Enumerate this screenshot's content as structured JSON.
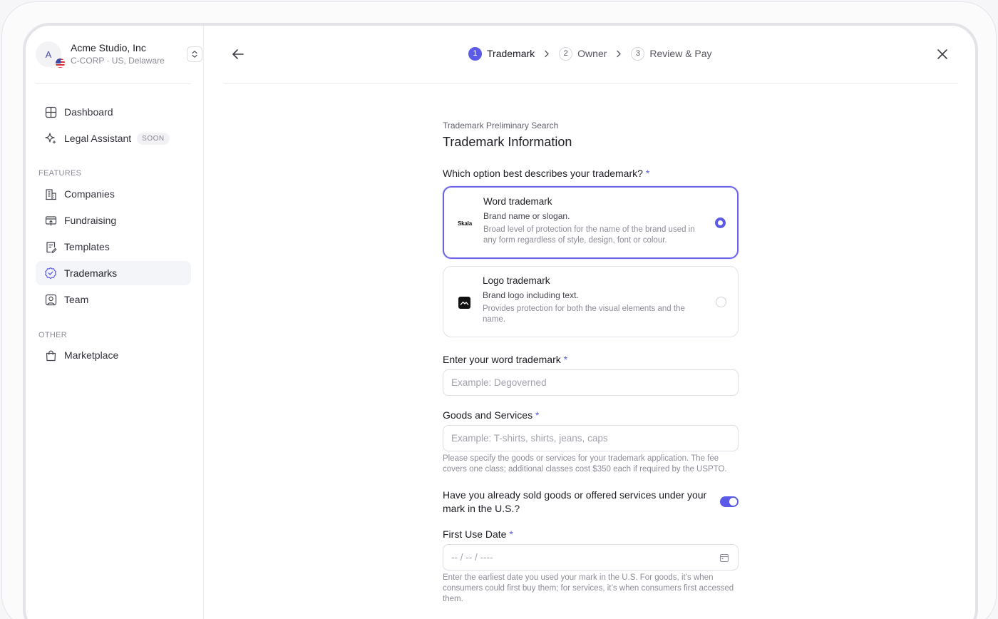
{
  "org": {
    "initial": "A",
    "name": "Acme Studio, Inc",
    "subtitle": "C-CORP · US, Delaware"
  },
  "sidebar": {
    "top_items": [
      {
        "label": "Dashboard",
        "icon": "dashboard-icon"
      },
      {
        "label": "Legal Assistant",
        "icon": "sparkle-icon",
        "badge": "SOON"
      }
    ],
    "features_label": "FEATURES",
    "features": [
      {
        "label": "Companies",
        "icon": "building-icon"
      },
      {
        "label": "Fundraising",
        "icon": "fundraising-icon"
      },
      {
        "label": "Templates",
        "icon": "template-icon"
      },
      {
        "label": "Trademarks",
        "icon": "trademark-icon",
        "active": true
      },
      {
        "label": "Team",
        "icon": "team-icon"
      }
    ],
    "other_label": "OTHER",
    "other": [
      {
        "label": "Marketplace",
        "icon": "bag-icon"
      }
    ]
  },
  "stepper": {
    "steps": [
      {
        "num": "1",
        "label": "Trademark",
        "active": true
      },
      {
        "num": "2",
        "label": "Owner",
        "active": false
      },
      {
        "num": "3",
        "label": "Review & Pay",
        "active": false
      }
    ]
  },
  "form": {
    "eyebrow": "Trademark Preliminary Search",
    "title": "Trademark Information",
    "type_question": "Which option best describes your trademark?",
    "required_mark": "*",
    "options": [
      {
        "logo_text": "Skala",
        "title": "Word trademark",
        "subtitle": "Brand name or slogan.",
        "description": "Broad level of protection for the name of the brand used in any form regardless of style, design, font or colour.",
        "selected": true
      },
      {
        "title": "Logo trademark",
        "subtitle": "Brand logo including text.",
        "description": "Provides protection for both the visual elements and the name.",
        "selected": false
      }
    ],
    "word_label": "Enter your word trademark",
    "word_placeholder": "Example: Degoverned",
    "goods_label": "Goods and Services",
    "goods_placeholder": "Example: T-shirts, shirts, jeans, caps",
    "goods_help": "Please specify the goods or services for your trademark application. The fee covers one class; additional classes cost $350 each if required by the USPTO.",
    "sold_question": "Have you already sold goods or offered services under your mark in the U.S.?",
    "sold_toggle_on": true,
    "first_use_label": "First Use Date",
    "first_use_placeholder": "-- / -- / ----",
    "first_use_help": "Enter the earliest date you used your mark in the U.S. For goods, it’s when consumers could first buy them; for services, it’s when consumers first accessed them."
  },
  "colors": {
    "accent": "#5b5be8",
    "selected_border": "#6c63e6"
  }
}
